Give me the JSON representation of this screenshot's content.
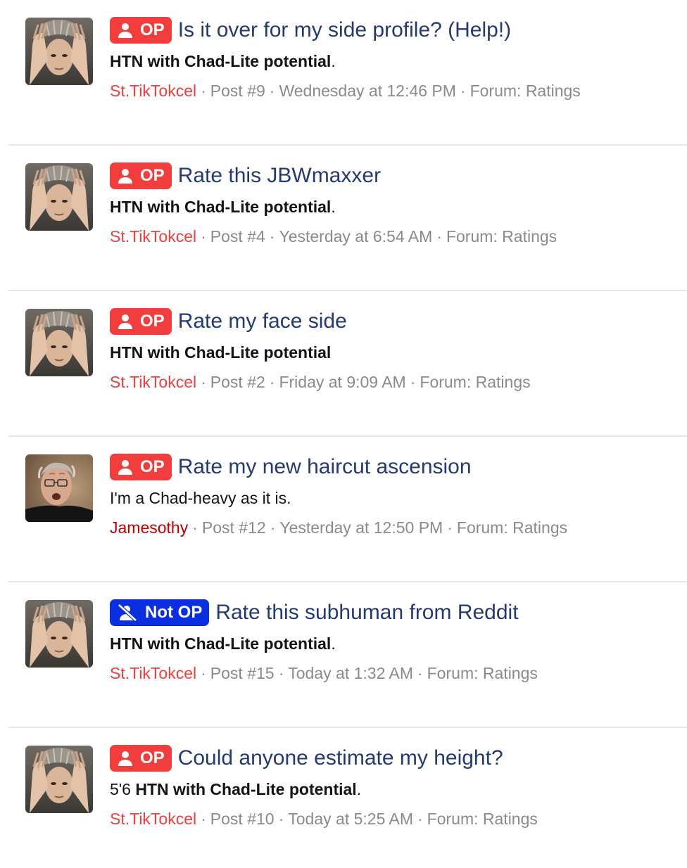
{
  "colors": {
    "op_badge": "#f23d3d",
    "not_op_badge": "#0b2ee0",
    "title": "#253a73",
    "meta": "#8a8a8a",
    "user_tiktokcel": "#f23d3d",
    "user_jamesothy": "#c00000"
  },
  "results": [
    {
      "avatar": "avatar-hands-on-head",
      "badge": "OP",
      "badge_icon": "user-icon",
      "title": "Is it over for my side profile? (Help!)",
      "snippet_prefix": "",
      "snippet_bold": "HTN with Chad-Lite potential",
      "snippet_suffix": ".",
      "user": "St.TikTokcel",
      "user_color": "#f23d3d",
      "post": "Post #9",
      "date": "Wednesday at 12:46 PM",
      "forum": "Forum: Ratings"
    },
    {
      "avatar": "avatar-hands-on-head",
      "badge": "OP",
      "badge_icon": "user-icon",
      "title": "Rate this JBWmaxxer",
      "snippet_prefix": "",
      "snippet_bold": "HTN with Chad-Lite potential",
      "snippet_suffix": ".",
      "user": "St.TikTokcel",
      "user_color": "#f23d3d",
      "post": "Post #4",
      "date": "Yesterday at 6:54 AM",
      "forum": "Forum: Ratings"
    },
    {
      "avatar": "avatar-hands-on-head",
      "badge": "OP",
      "badge_icon": "user-icon",
      "title": "Rate my face side",
      "snippet_prefix": "",
      "snippet_bold": "HTN with Chad-Lite potential",
      "snippet_suffix": "",
      "user": "St.TikTokcel",
      "user_color": "#f23d3d",
      "post": "Post #2",
      "date": "Friday at 9:09 AM",
      "forum": "Forum: Ratings"
    },
    {
      "avatar": "avatar-glasses-man",
      "badge": "OP",
      "badge_icon": "user-icon",
      "title": "Rate my new haircut ascension",
      "snippet_prefix": "I'm a Chad-heavy as it is.",
      "snippet_bold": "",
      "snippet_suffix": "",
      "user": "Jamesothy",
      "user_color": "#c00000",
      "post": "Post #12",
      "date": "Yesterday at 12:50 PM",
      "forum": "Forum: Ratings"
    },
    {
      "avatar": "avatar-hands-on-head",
      "badge": "Not OP",
      "badge_icon": "user-slash-icon",
      "title": "Rate this subhuman from Reddit",
      "snippet_prefix": "",
      "snippet_bold": "HTN with Chad-Lite potential",
      "snippet_suffix": ".",
      "user": "St.TikTokcel",
      "user_color": "#f23d3d",
      "post": "Post #15",
      "date": "Today at 1:32 AM",
      "forum": "Forum: Ratings"
    },
    {
      "avatar": "avatar-hands-on-head",
      "badge": "OP",
      "badge_icon": "user-icon",
      "title": "Could anyone estimate my height?",
      "snippet_prefix": "5'6 ",
      "snippet_bold": "HTN with Chad-Lite potential",
      "snippet_suffix": ".",
      "user": "St.TikTokcel",
      "user_color": "#f23d3d",
      "post": "Post #10",
      "date": "Today at 5:25 AM",
      "forum": "Forum: Ratings"
    }
  ]
}
